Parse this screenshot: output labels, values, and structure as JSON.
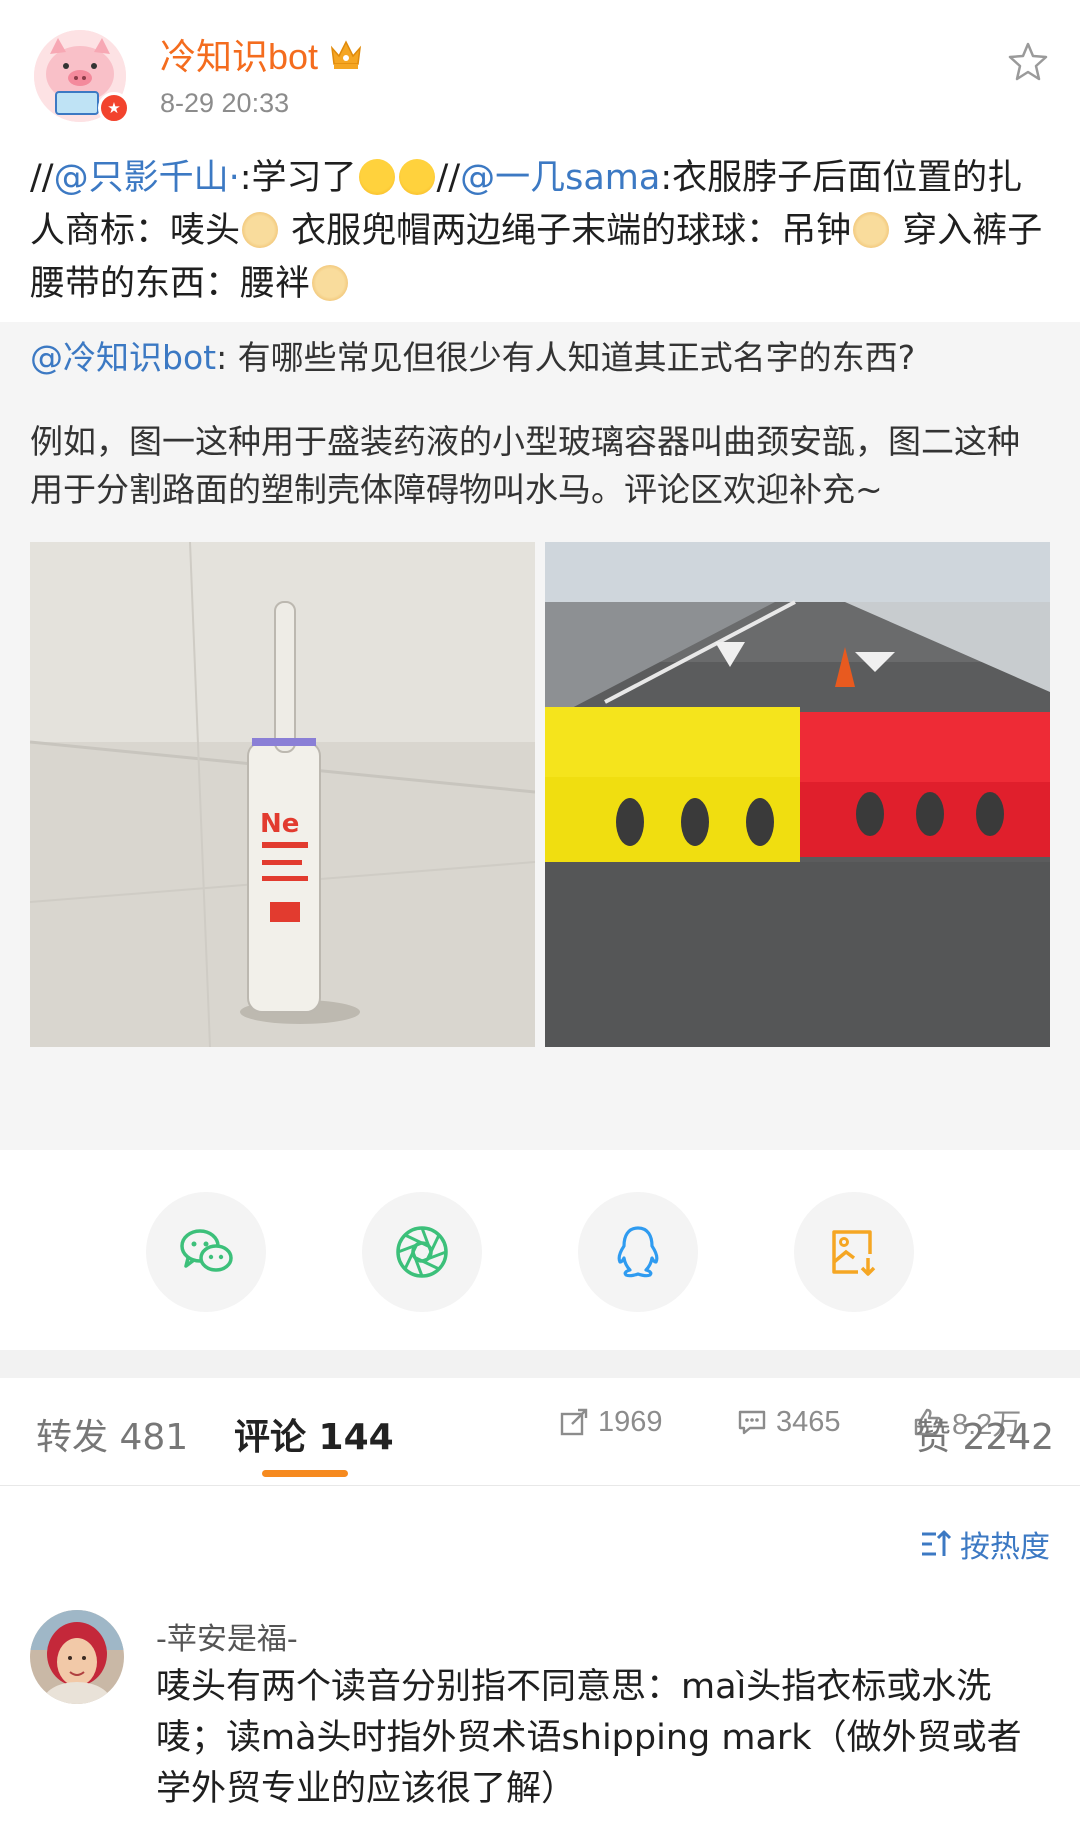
{
  "post": {
    "username": "冷知识bot",
    "timestamp": "8-29 20:33",
    "repost_prefix": "//",
    "mention1": "@只影千山·",
    "text1": ":学习了",
    "repost_sep": "//",
    "mention2": "@一几sama",
    "text2": ":衣服脖子后面位置的扎人商标：唛头",
    "text3": " 衣服兜帽两边绳子末端的球球：吊钟",
    "text4": " 穿入裤子腰带的东西：腰袢"
  },
  "quoted": {
    "mention": "@冷知识bot",
    "line1": ": 有哪些常见但很少有人知道其正式名字的东西?",
    "paragraph2": "例如，图一这种用于盛装药液的小型玻璃容器叫曲颈安瓿，图二这种用于分割路面的塑制壳体障碍物叫水马。评论区欢迎补充~",
    "stats": {
      "reposts": "1969",
      "comments": "3465",
      "likes": "8.2万"
    }
  },
  "share": {
    "icons": [
      "wechat-icon",
      "moments-icon",
      "qq-icon",
      "save-image-icon"
    ],
    "colors": {
      "wechat": "#3cc07a",
      "moments": "#3cc07a",
      "qq": "#2f9bf0",
      "save": "#f5a623"
    }
  },
  "tabs": {
    "repost": "转发 481",
    "comment": "评论 144",
    "like": "赞 2242"
  },
  "sort": {
    "label": "按热度"
  },
  "comment": {
    "user": "-苹安是福-",
    "text": "唛头有两个读音分别指不同意思：maì头指衣标或水洗唛；读mà头时指外贸术语shipping mark（做外贸或者学外贸专业的应该很了解）"
  },
  "colors": {
    "accent": "#f46c1e",
    "link": "#3c79c3",
    "tab_indicator": "#f68a1f"
  }
}
